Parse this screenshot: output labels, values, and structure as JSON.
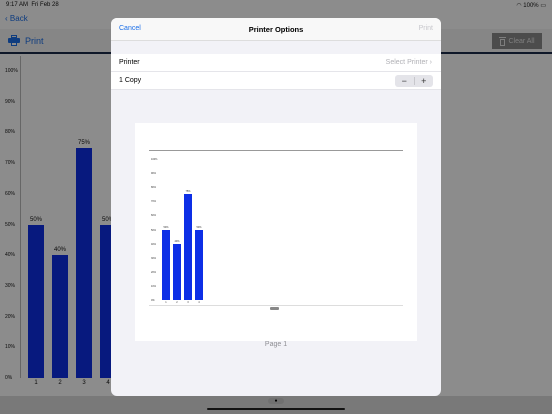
{
  "status_bar": {
    "time": "9:17 AM",
    "date": "Fri Feb 28",
    "battery": "100%"
  },
  "nav": {
    "back_label": "Back"
  },
  "toolbar": {
    "print_label": "Print",
    "clear_all_label": "Clear All"
  },
  "chart_data": {
    "type": "bar",
    "categories": [
      "1",
      "2",
      "3",
      "4"
    ],
    "values": [
      50,
      40,
      75,
      50
    ],
    "data_labels": [
      "50%",
      "40%",
      "75%",
      "50%"
    ],
    "y_ticks": [
      "100%",
      "90%",
      "80%",
      "70%",
      "60%",
      "50%",
      "40%",
      "30%",
      "20%",
      "10%",
      "0%"
    ],
    "ylim": [
      0,
      100
    ],
    "bar_color": "#0d2fe6"
  },
  "modal": {
    "cancel_label": "Cancel",
    "title": "Printer Options",
    "print_label": "Print",
    "printer_label": "Printer",
    "printer_value": "Select Printer",
    "copies_label": "1 Copy",
    "stepper_minus": "−",
    "stepper_plus": "+",
    "page_label": "Page 1"
  },
  "colors": {
    "accent": "#1a6ee8",
    "bar": "#0d2fe6"
  },
  "icons": [
    "printer-icon",
    "trash-icon",
    "chevron-left-icon",
    "chevron-right-icon",
    "wifi-icon",
    "battery-icon"
  ]
}
